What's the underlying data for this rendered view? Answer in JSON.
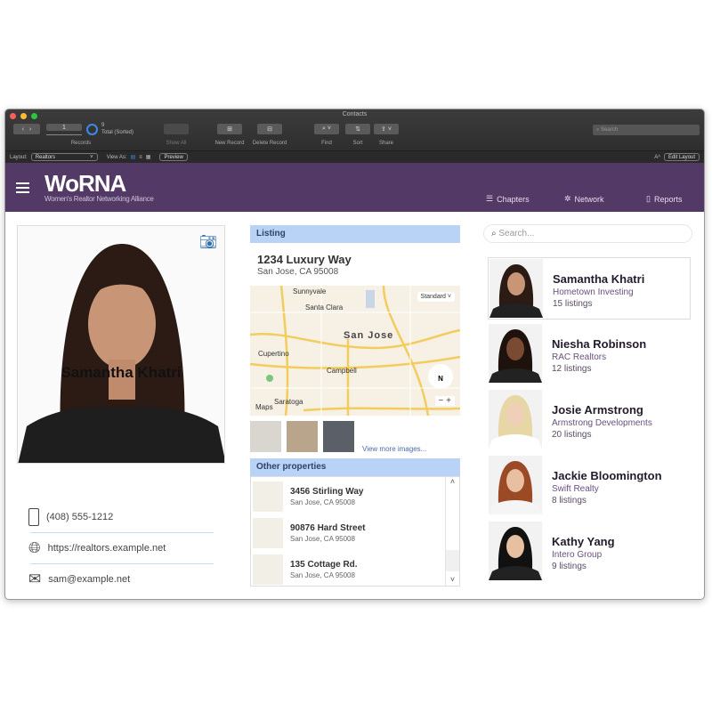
{
  "window": {
    "title": "Contacts"
  },
  "toolbar": {
    "record_number": "1",
    "total_count": "9",
    "total_label": "Total (Sorted)",
    "records_label": "Records",
    "show_all": "Show All",
    "new_record": "New Record",
    "delete_record": "Delete Record",
    "find": "Find",
    "sort": "Sort",
    "share": "Share",
    "search_placeholder": "Search"
  },
  "layoutbar": {
    "layout_label": "Layout:",
    "layout_value": "Realtors",
    "view_as_label": "View As:",
    "preview": "Preview",
    "edit_layout": "Edit Layout"
  },
  "header": {
    "logo": "WoRNA",
    "tagline": "Women's Realtor Networking Alliance",
    "nav": [
      {
        "label": "Chapters",
        "icon": "list-icon"
      },
      {
        "label": "Network",
        "icon": "network-icon"
      },
      {
        "label": "Reports",
        "icon": "document-icon"
      }
    ]
  },
  "profile": {
    "name": "Samantha Khatri",
    "phone": "(408) 555-1212",
    "website": "https://realtors.example.net",
    "email": "sam@example.net"
  },
  "listing": {
    "section_title": "Listing",
    "address": "1234 Luxury Way",
    "city": "San Jose, CA 95008",
    "map": {
      "type_select": "Standard",
      "labels": [
        "Sunnyvale",
        "Santa Clara",
        "San Jose",
        "Cupertino",
        "Campbell",
        "Saratoga"
      ],
      "attribution": "Maps"
    },
    "view_more": "View more images..."
  },
  "other_properties": {
    "section_title": "Other properties",
    "items": [
      {
        "address": "3456 Stirling Way",
        "city": "San Jose, CA 95008"
      },
      {
        "address": "90876 Hard Street",
        "city": "San Jose, CA 95008"
      },
      {
        "address": "135 Cottage Rd.",
        "city": "San Jose, CA 95008"
      }
    ]
  },
  "agents": {
    "search_placeholder": "Search...",
    "items": [
      {
        "name": "Samantha Khatri",
        "company": "Hometown Investing",
        "listings": "15 listings",
        "selected": true
      },
      {
        "name": "Niesha Robinson",
        "company": "RAC Realtors",
        "listings": "12 listings"
      },
      {
        "name": "Josie Armstrong",
        "company": "Armstrong Developments",
        "listings": "20 listings"
      },
      {
        "name": "Jackie Bloomington",
        "company": "Swift Realty",
        "listings": "8 listings"
      },
      {
        "name": "Kathy Yang",
        "company": "Intero Group",
        "listings": "9 listings"
      }
    ]
  },
  "colors": {
    "brand": "#533a66",
    "section": "#b9d3f6"
  }
}
